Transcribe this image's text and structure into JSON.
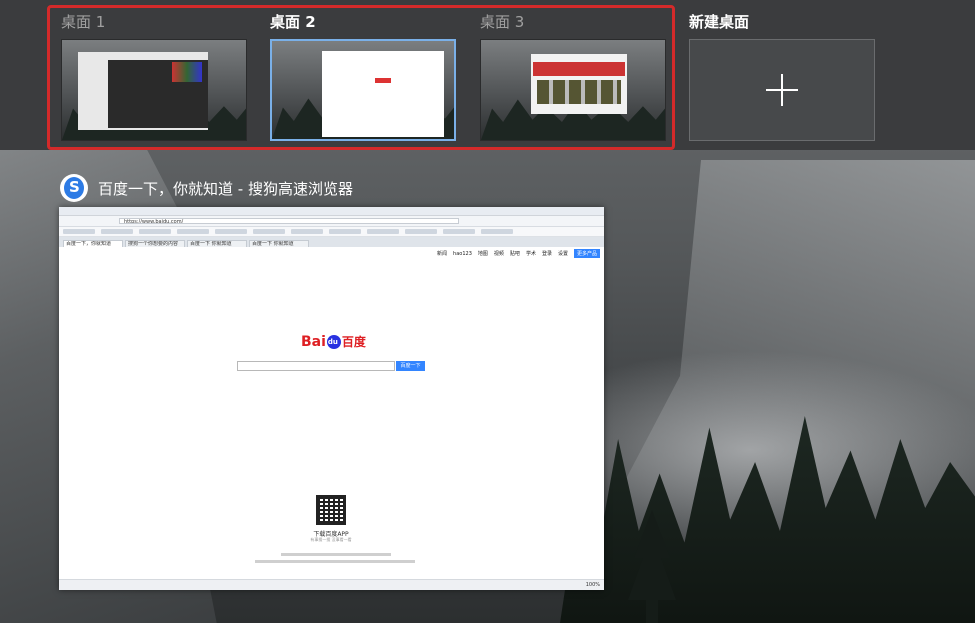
{
  "desktops": [
    {
      "label": "桌面 1",
      "active": false
    },
    {
      "label": "桌面 2",
      "active": true
    },
    {
      "label": "桌面 3",
      "active": false
    }
  ],
  "new_desktop": {
    "label": "新建桌面",
    "icon": "plus-icon"
  },
  "window": {
    "title": "百度一下，你就知道 - 搜狗高速浏览器",
    "icon": "sogou-browser-icon",
    "browser": {
      "address": "https://www.baidu.com/",
      "tabs": [
        "百度一下，你就知道",
        "搜狗一个你想要的内容",
        "百度一下 你就知道",
        "百度一下 你就知道"
      ],
      "top_links": [
        "新闻",
        "hao123",
        "地图",
        "视频",
        "贴吧",
        "学术",
        "登录",
        "设置",
        "更多产品"
      ],
      "logo_left": "Bai",
      "logo_paw": "du",
      "logo_right": "百度",
      "search_button": "百度一下",
      "qr_title": "下载百度APP",
      "qr_subtitle": "有事搜一搜  没事看一看",
      "zoom": "100%"
    }
  },
  "colors": {
    "highlight_border": "#d42a2a",
    "active_border": "#7ab0e8",
    "baidu_blue": "#3385ff",
    "baidu_red": "#de1f23"
  }
}
